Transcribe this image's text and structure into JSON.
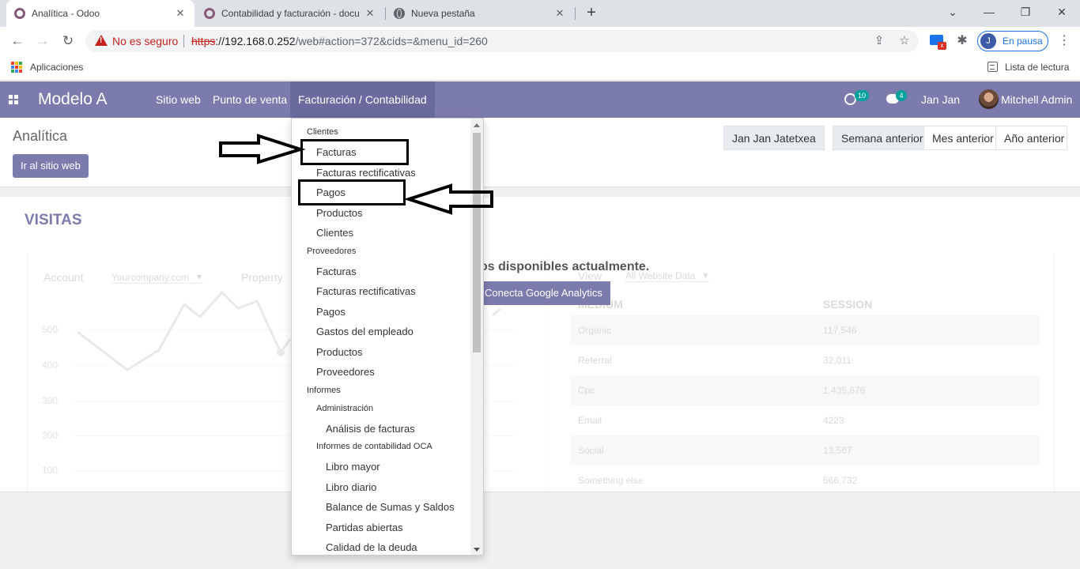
{
  "browser": {
    "tabs": [
      {
        "title": "Analítica - Odoo",
        "favicon": "odoo-icon",
        "active": true
      },
      {
        "title": "Contabilidad y facturación - docu",
        "favicon": "odoo-icon",
        "active": false
      },
      {
        "title": "Nueva pestaña",
        "favicon": "globe-icon",
        "active": false
      }
    ],
    "close_glyph": "✕",
    "new_tab_glyph": "+",
    "window_controls": [
      "⌄",
      "—",
      "❐",
      "✕"
    ],
    "security_label": "No es seguro",
    "url_scheme": "https",
    "url_rest": "://192.168.0.252",
    "url_path": "/web#action=372&cids=&menu_id=260",
    "profile_initial": "J",
    "profile_label": "En pausa",
    "bookmarks": {
      "apps_label": "Aplicaciones",
      "reading_list": "Lista de lectura"
    },
    "colors": {
      "warning": "#c5221f",
      "accent": "#1a73e8"
    }
  },
  "navbar": {
    "brand": "Modelo A",
    "menu": [
      "Sitio web",
      "Punto de venta",
      "Facturación / Contabilidad"
    ],
    "activity_count": "10",
    "message_count": "4",
    "company": "Jan Jan",
    "user": "Mitchell Admin",
    "colors": {
      "bar": "#7c7bad",
      "active": "#6a6a9f",
      "badge": "#00a09d"
    }
  },
  "control_panel": {
    "title": "Analítica",
    "website_button": "Ir al sitio web",
    "website_selector": "Jan Jan Jatetxea",
    "periods": [
      "Semana anterior",
      "Mes anterior",
      "Año anterior"
    ]
  },
  "dashboard": {
    "section_title": "VISITAS",
    "message": "os disponibles actualmente.",
    "connect_button": "Conecta Google Analytics",
    "account_label": "Account",
    "account_value": "Yourcompany.com",
    "property_label": "Property",
    "view_label": "View",
    "view_value": "All Website Data",
    "y_ticks": [
      "500",
      "400",
      "300",
      "200",
      "100"
    ],
    "table_headers": [
      "MEDIUM",
      "SESSION"
    ],
    "table_rows": [
      [
        "Organic",
        "117,546"
      ],
      [
        "Referral",
        "32,011"
      ],
      [
        "Cpc",
        "1,435,676"
      ],
      [
        "Email",
        "4223"
      ],
      [
        "Social",
        "13,567"
      ],
      [
        "Something else",
        "566,732"
      ]
    ]
  },
  "dropdown": {
    "items": [
      {
        "label": "Clientes",
        "kind": "header",
        "level": 0
      },
      {
        "label": "Facturas",
        "kind": "entry",
        "level": 1
      },
      {
        "label": "Facturas rectificativas",
        "kind": "entry",
        "level": 1
      },
      {
        "label": "Pagos",
        "kind": "entry",
        "level": 1
      },
      {
        "label": "Productos",
        "kind": "entry",
        "level": 1
      },
      {
        "label": "Clientes",
        "kind": "entry",
        "level": 1
      },
      {
        "label": "Proveedores",
        "kind": "header",
        "level": 0
      },
      {
        "label": "Facturas",
        "kind": "entry",
        "level": 1
      },
      {
        "label": "Facturas rectificativas",
        "kind": "entry",
        "level": 1
      },
      {
        "label": "Pagos",
        "kind": "entry",
        "level": 1
      },
      {
        "label": "Gastos del empleado",
        "kind": "entry",
        "level": 1
      },
      {
        "label": "Productos",
        "kind": "entry",
        "level": 1
      },
      {
        "label": "Proveedores",
        "kind": "entry",
        "level": 1
      },
      {
        "label": "Informes",
        "kind": "header",
        "level": 0
      },
      {
        "label": "Administración",
        "kind": "header",
        "level": 1
      },
      {
        "label": "Análisis de facturas",
        "kind": "entry",
        "level": 2
      },
      {
        "label": "Informes de contabilidad OCA",
        "kind": "header",
        "level": 1
      },
      {
        "label": "Libro mayor",
        "kind": "entry",
        "level": 2
      },
      {
        "label": "Libro diario",
        "kind": "entry",
        "level": 2
      },
      {
        "label": "Balance de Sumas y Saldos",
        "kind": "entry",
        "level": 2
      },
      {
        "label": "Partidas abiertas",
        "kind": "entry",
        "level": 2
      },
      {
        "label": "Calidad de la deuda",
        "kind": "entry",
        "level": 2
      }
    ]
  }
}
